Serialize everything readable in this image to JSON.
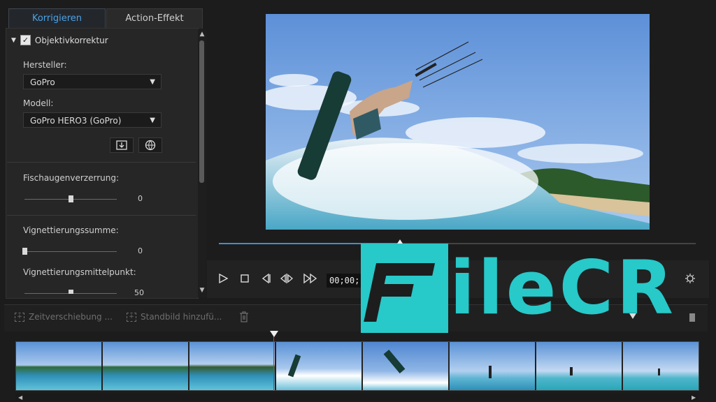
{
  "tabs": [
    {
      "label": "Korrigieren",
      "active": true
    },
    {
      "label": "Action-Effekt",
      "active": false
    }
  ],
  "lens": {
    "title": "Objektivkorrektur",
    "checked": true,
    "manufacturer_label": "Hersteller:",
    "manufacturer_value": "GoPro",
    "model_label": "Modell:",
    "model_value": "GoPro HERO3 (GoPro)"
  },
  "sliders": [
    {
      "label": "Fischaugenverzerrung:",
      "value": "0",
      "fraction": 0.5
    },
    {
      "label": "Vignettierungssumme:",
      "value": "0",
      "fraction": 0.0
    },
    {
      "label": "Vignettierungsmittelpunkt:",
      "value": "50",
      "fraction": 0.5
    }
  ],
  "player": {
    "timecode": "00;00;",
    "progress_fraction": 0.38
  },
  "timeline": {
    "time_shift_label": "Zeitverschiebung ...",
    "freeze_frame_label": "Standbild hinzufü..."
  },
  "watermark": {
    "text": "ileCR"
  },
  "colors": {
    "accent": "#3d8fd1",
    "tab_active": "#4aa3e8",
    "watermark": "#27c9c9"
  },
  "icons": [
    "check-icon",
    "save-icon",
    "download-globe-icon",
    "play-icon",
    "stop-icon",
    "prev-frame-icon",
    "split-icon",
    "next-frame-icon",
    "settings-icon",
    "trash-icon"
  ]
}
